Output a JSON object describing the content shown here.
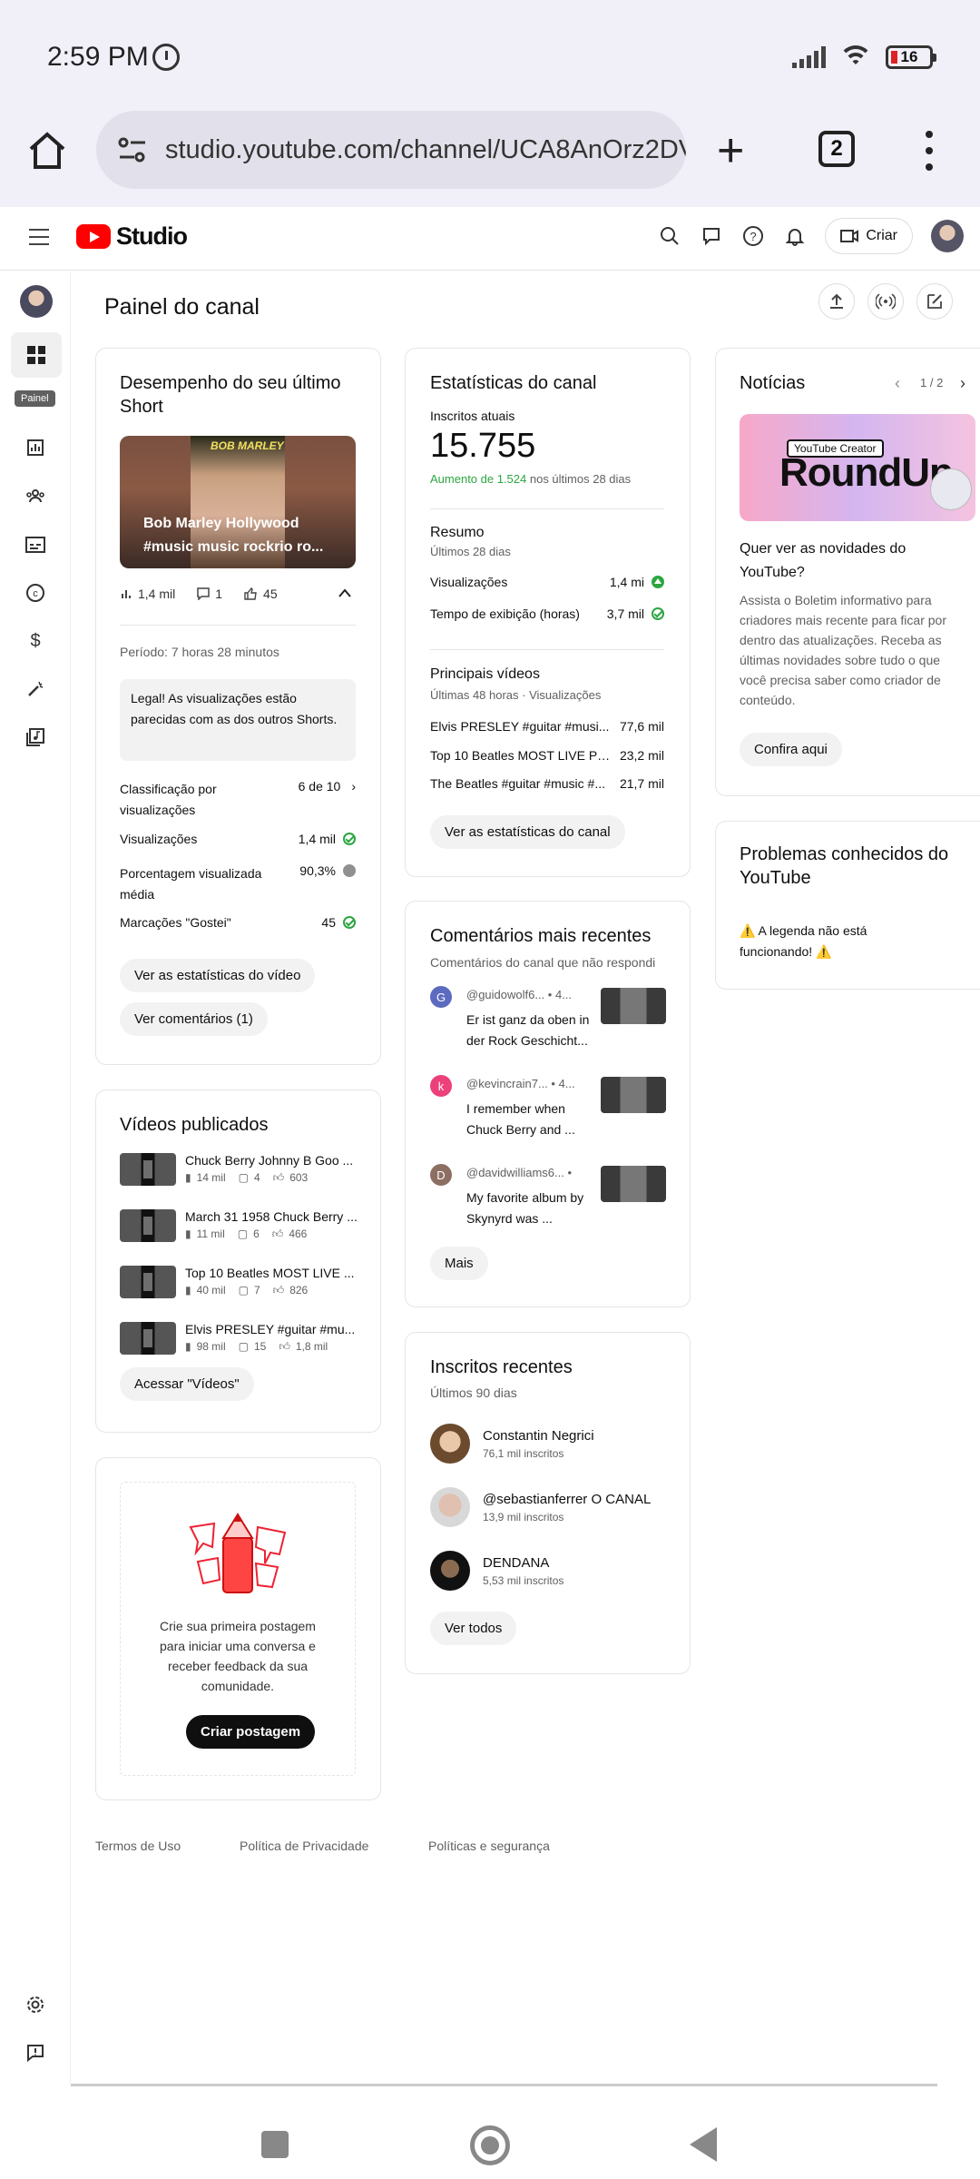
{
  "status_bar": {
    "time": "2:59 PM",
    "battery": "16"
  },
  "browser": {
    "url": "studio.youtube.com/channel/UCA8AnOrz2DV",
    "tab_count": "2"
  },
  "header": {
    "create_label": "Criar"
  },
  "sidebar": {
    "tooltip": "Painel"
  },
  "page": {
    "title": "Painel do canal"
  },
  "short_card": {
    "title": "Desempenho do seu último Short",
    "thumb_brand": "BOB MARLEY",
    "thumb_caption": "Bob Marley Hollywood #music music rockrio ro...",
    "views": "1,4 mil",
    "comments": "1",
    "likes": "45",
    "period": "Período: 7 horas 28 minutos",
    "tip": "Legal! As visualizações estão parecidas com as dos outros Shorts.",
    "rows": [
      {
        "label": "Classificação por visualizações",
        "value": "6 de 10"
      },
      {
        "label": "Visualizações",
        "value": "1,4 mil"
      },
      {
        "label": "Porcentagem visualizada média",
        "value": "90,3%"
      },
      {
        "label": "Marcações \"Gostei\"",
        "value": "45"
      }
    ],
    "btn_stats": "Ver as estatísticas do vídeo",
    "btn_comments": "Ver comentários (1)"
  },
  "published": {
    "title": "Vídeos publicados",
    "items": [
      {
        "title": "Chuck Berry Johnny B Goo ...",
        "views": "14 mil",
        "comments": "4",
        "likes": "603"
      },
      {
        "title": "March 31 1958 Chuck Berry ...",
        "views": "11 mil",
        "comments": "6",
        "likes": "466"
      },
      {
        "title": "Top 10 Beatles MOST LIVE ...",
        "views": "40 mil",
        "comments": "7",
        "likes": "826"
      },
      {
        "title": "Elvis PRESLEY #guitar #mu...",
        "views": "98 mil",
        "comments": "15",
        "likes": "1,8 mil"
      }
    ],
    "btn": "Acessar \"Vídeos\""
  },
  "post_card": {
    "text": "Crie sua primeira postagem para iniciar uma conversa e receber feedback da sua comunidade.",
    "btn": "Criar postagem"
  },
  "stats_card": {
    "title": "Estatísticas do canal",
    "subs_label": "Inscritos atuais",
    "subs_value": "15.755",
    "increase": "Aumento de 1.524",
    "increase_suffix": " nos últimos 28 dias",
    "summary_title": "Resumo",
    "summary_sub": "Últimos 28 dias",
    "summary_rows": [
      {
        "label": "Visualizações",
        "value": "1,4 mi"
      },
      {
        "label": "Tempo de exibição (horas)",
        "value": "3,7 mil"
      }
    ],
    "top_title": "Principais vídeos",
    "top_sub": "Últimas 48 horas · Visualizações",
    "top_rows": [
      {
        "label": "Elvis PRESLEY #guitar #musi...",
        "value": "77,6 mil"
      },
      {
        "label": "Top 10 Beatles MOST LIVE PE...",
        "value": "23,2 mil"
      },
      {
        "label": "The Beatles #guitar #music #...",
        "value": "21,7 mil"
      }
    ],
    "btn": "Ver as estatísticas do canal"
  },
  "comments_card": {
    "title": "Comentários mais recentes",
    "sub": "Comentários do canal que não respondi",
    "items": [
      {
        "initial": "G",
        "color": "#5c6bc0",
        "name": "@guidowolf6... • 4...",
        "text": "Er ist ganz da oben in der Rock Geschicht..."
      },
      {
        "initial": "k",
        "color": "#ec407a",
        "name": "@kevincrain7... • 4...",
        "text": "I remember when Chuck Berry and ..."
      },
      {
        "initial": "D",
        "color": "#8d6e63",
        "name": "@davidwilliams6... • ",
        "text": "My favorite album by Skynyrd was  ..."
      }
    ],
    "btn": "Mais"
  },
  "subs_card": {
    "title": "Inscritos recentes",
    "sub": "Últimos 90 dias",
    "items": [
      {
        "name": "Constantin Negrici",
        "count": "76,1 mil inscritos"
      },
      {
        "name": "@sebastianferrer O CANAL",
        "count": "13,9 mil inscritos"
      },
      {
        "name": "DENDANA",
        "count": "5,53 mil inscritos"
      }
    ],
    "btn": "Ver todos"
  },
  "news_card": {
    "title": "Notícias",
    "pager": "1 / 2",
    "img_tag": "YouTube Creator",
    "img_word": "RoundUp",
    "headline": "Quer ver as novidades do YouTube?",
    "body": "Assista o Boletim informativo para criadores mais recente para ficar por dentro das atualizações. Receba as últimas novidades sobre tudo o que você precisa saber como criador de conteúdo.",
    "btn": "Confira aqui"
  },
  "issues_card": {
    "title": "Problemas conhecidos do YouTube",
    "text": "⚠️ A legenda não está funcionando! ⚠️"
  },
  "footer": {
    "terms": "Termos de Uso",
    "privacy": "Política de Privacidade",
    "safety": "Políticas e segurança"
  },
  "colors": {
    "brand": "#ff0000",
    "positive": "#2ba640"
  }
}
